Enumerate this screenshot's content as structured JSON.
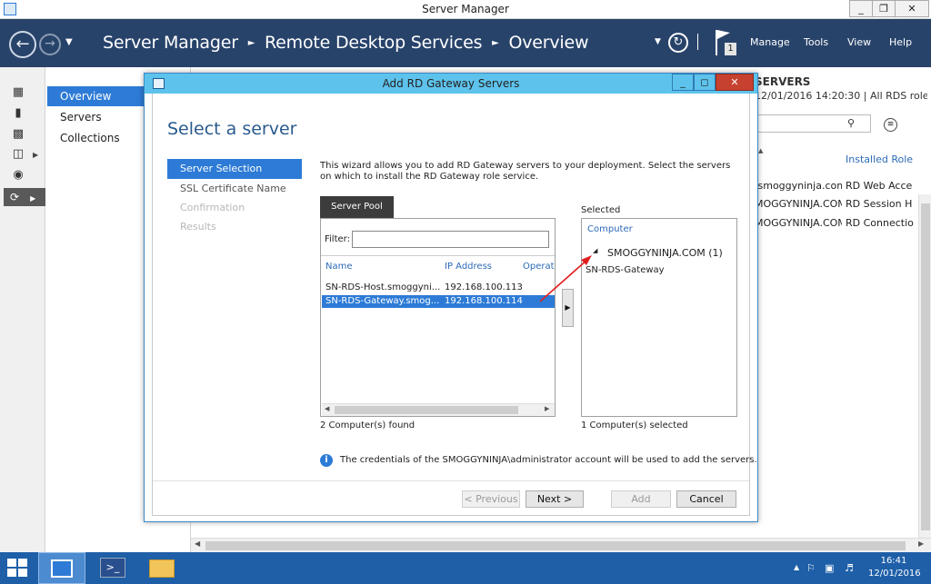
{
  "window": {
    "title": "Server Manager",
    "min": "_",
    "max": "❐",
    "close": "✕"
  },
  "header": {
    "breadcrumb": [
      "Server Manager",
      "Remote Desktop Services",
      "Overview"
    ],
    "menus": [
      "Manage",
      "Tools",
      "View",
      "Help"
    ],
    "flag_badge": "1"
  },
  "leftnav": {
    "items": [
      "Overview",
      "Servers",
      "Collections"
    ]
  },
  "background": {
    "servers_heading": "SERVERS",
    "last_refreshed": "12/01/2016 14:20:30 | All RDS role",
    "col_installed_roles": "Installed Role",
    "rows": [
      {
        "server": ".smoggyninja.com",
        "role": "RD Web Acce"
      },
      {
        "server": "MOGGYNINJA.COM",
        "role": "RD Session H"
      },
      {
        "server": "MOGGYNINJA.COM",
        "role": "RD Connectio"
      }
    ]
  },
  "dialog": {
    "title": "Add RD Gateway Servers",
    "heading": "Select a server",
    "steps": [
      "Server Selection",
      "SSL Certificate Name",
      "Confirmation",
      "Results"
    ],
    "description": "This wizard allows you to add RD Gateway servers to your deployment. Select the servers on which to install the RD Gateway role service.",
    "tab": "Server Pool",
    "filter_label": "Filter:",
    "filter_value": "",
    "columns": [
      "Name",
      "IP Address",
      "Operat"
    ],
    "rows": [
      {
        "name": "SN-RDS-Host.smoggyni...",
        "ip": "192.168.100.113"
      },
      {
        "name": "SN-RDS-Gateway.smog...",
        "ip": "192.168.100.114"
      }
    ],
    "found_count": "2 Computer(s) found",
    "selected_label": "Selected",
    "selected_col": "Computer",
    "selected_group": "SMOGGYNINJA.COM (1)",
    "selected_item": "SN-RDS-Gateway",
    "selected_count": "1 Computer(s) selected",
    "info": "The credentials of the SMOGGYNINJA\\administrator account will be used to add the servers.",
    "buttons": {
      "previous": "< Previous",
      "next": "Next >",
      "add": "Add",
      "cancel": "Cancel"
    }
  },
  "taskbar": {
    "time": "16:41",
    "date": "12/01/2016"
  },
  "colors": {
    "header": "#28436a",
    "accent": "#2d7bd6",
    "dialog_title": "#5ec3ec",
    "taskbar": "#1e5fa8"
  }
}
